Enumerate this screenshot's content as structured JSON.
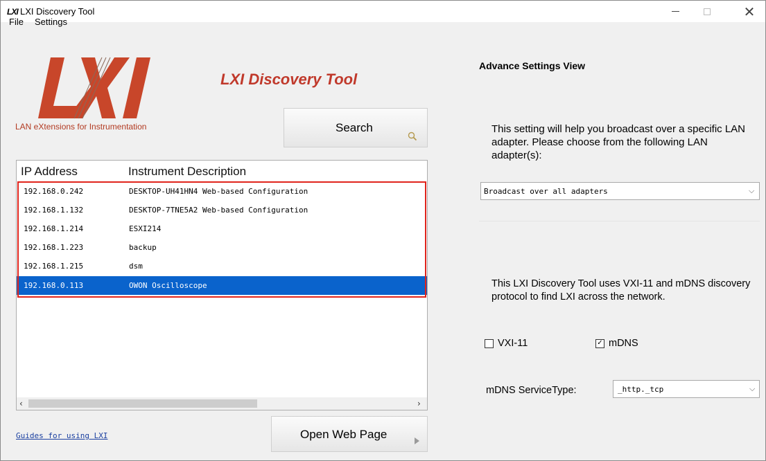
{
  "window": {
    "icon_text": "LXI",
    "title": "LXI Discovery Tool",
    "minimize": "—",
    "maximize": "□",
    "close": "✕"
  },
  "menu": {
    "file": "File",
    "settings": "Settings"
  },
  "logo": {
    "subtitle": "LAN eXtensions for Instrumentation"
  },
  "heading": "LXI Discovery Tool",
  "search_button": "Search",
  "list": {
    "columns": [
      "IP Address",
      "Instrument Description"
    ],
    "rows": [
      {
        "ip": "192.168.0.242",
        "desc": "DESKTOP-UH41HN4 Web-based Configuration"
      },
      {
        "ip": "192.168.1.132",
        "desc": "DESKTOP-7TNE5A2 Web-based Configuration"
      },
      {
        "ip": "192.168.1.214",
        "desc": "ESXI214"
      },
      {
        "ip": "192.168.1.223",
        "desc": "backup"
      },
      {
        "ip": "192.168.1.215",
        "desc": "dsm"
      },
      {
        "ip": "192.168.0.113",
        "desc": "OWON Oscilloscope"
      }
    ],
    "selected_index": 5
  },
  "guides_link": "Guides for using LXI",
  "open_button": "Open Web Page",
  "right": {
    "title": "Advance Settings View",
    "description": "This setting will help you broadcast over a specific LAN adapter. Please choose from the following LAN adapter(s):",
    "adapter_value": "Broadcast over all adapters",
    "protocol_description": "This LXI Discovery Tool uses  VXI-11 and mDNS discovery protocol to find LXI across the network.",
    "vxi_label": "VXI-11",
    "vxi_checked": false,
    "mdns_label": "mDNS",
    "mdns_checked": true,
    "service_label": "mDNS ServiceType:",
    "service_value": "_http._tcp"
  },
  "colors": {
    "selection": "#0a63cc",
    "highlight_frame": "#e0241b",
    "brand": "#c0392b"
  }
}
